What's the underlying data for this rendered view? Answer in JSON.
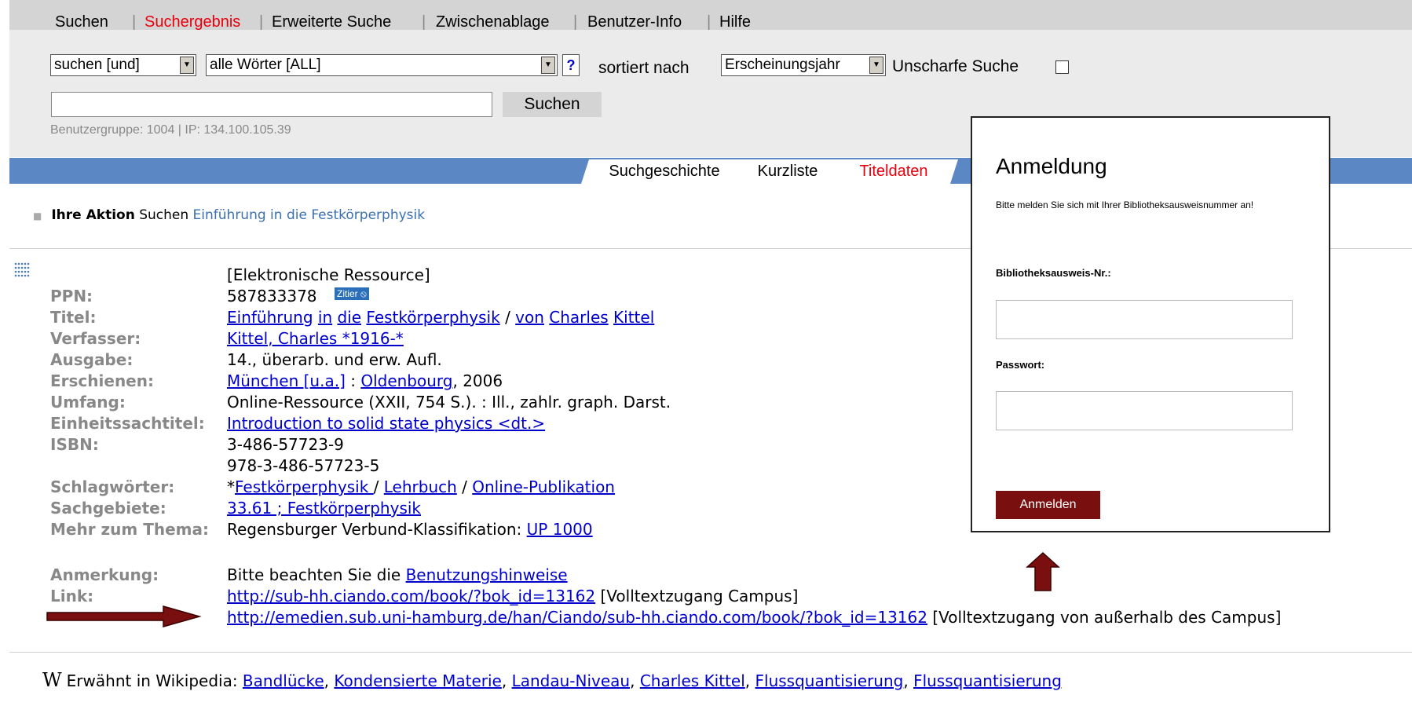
{
  "menu": {
    "items": [
      "Suchen",
      "Suchergebnis",
      "Erweiterte Suche",
      "Zwischenablage",
      "Benutzer-Info",
      "Hilfe"
    ],
    "active_index": 1,
    "active_color": "#e8000d"
  },
  "search": {
    "operator_value": "suchen [und]",
    "field_value": "alle Wörter [ALL]",
    "help_label": "?",
    "sort_label": "sortiert nach",
    "sort_value": "Erscheinungsjahr",
    "fuzzy_label": "Unscharfe Suche",
    "fuzzy_checked": false,
    "query_value": "",
    "submit_label": "Suchen",
    "user_info": "Benutzergruppe: 1004 | IP: 134.100.105.39"
  },
  "tabs": {
    "items": [
      "Suchgeschichte",
      "Kurzliste",
      "Titeldaten"
    ],
    "active_index": 2,
    "bar_color": "#5b87c5"
  },
  "action": {
    "label": "Ihre Aktion",
    "verb": "Suchen",
    "query": "Einführung in die Festkörperphysik"
  },
  "record": {
    "resource_type": "[Elektronische Ressource]",
    "ppn_label": "PPN:",
    "ppn": "587833378",
    "zitier_label": "Zitier",
    "title_label": "Titel:",
    "title_words": [
      "Einführung",
      "in",
      "die",
      "Festkörperphysik",
      "/",
      "von",
      "Charles",
      "Kittel"
    ],
    "author_label": "Verfasser:",
    "author": "Kittel, Charles *1916-*",
    "edition_label": "Ausgabe:",
    "edition": "14., überarb. und erw. Aufl.",
    "published_label": "Erschienen:",
    "published_place": "München [u.a.]",
    "published_sep": " : ",
    "published_publisher": "Oldenbourg",
    "published_year": ", 2006",
    "extent_label": "Umfang:",
    "extent": "Online-Ressource (XXII, 754 S.). : Ill., zahlr. graph. Darst.",
    "uniform_title_label": "Einheitssachtitel:",
    "uniform_title": "Introduction to solid state physics <dt.>",
    "isbn_label": "ISBN:",
    "isbn_1": "3-486-57723-9",
    "isbn_2": "978-3-486-57723-5",
    "subjects_label": "Schlagwörter:",
    "subject_prefix": "*",
    "subject_1": "Festkörperphysik ",
    "subject_2": "Lehrbuch",
    "subject_3": "Online-Publikation",
    "subjects_sep": " / ",
    "classification_label": "Sachgebiete:",
    "classification": "33.61 ; Festkörperphysik",
    "more_label": "Mehr zum Thema:",
    "more_text": "Regensburger Verbund-Klassifikation: ",
    "more_link": "UP 1000",
    "note_label": "Anmerkung:",
    "note_text": "Bitte beachten Sie die ",
    "note_link": "Benutzungshinweise",
    "link_label": "Link:",
    "link_1_url": "http://sub-hh.ciando.com/book/?bok_id=13162",
    "link_1_note": " [Volltextzugang Campus]",
    "link_2_url": "http://emedien.sub.uni-hamburg.de/han/Ciando/sub-hh.ciando.com/book/?bok_id=13162",
    "link_2_note": " [Volltextzugang von außerhalb des Campus]"
  },
  "login": {
    "title": "Anmeldung",
    "subtitle": "Bitte melden Sie sich mit Ihrer Bibliotheksausweisnummer an!",
    "card_label": "Bibliotheksausweis-Nr.:",
    "card_value": "",
    "password_label": "Passwort:",
    "password_value": "",
    "submit_label": "Anmelden",
    "button_color": "#7a0f0f"
  },
  "annotation": {
    "arrow_color": "#7a0f0f"
  },
  "wiki": {
    "icon": "W",
    "label": "Erwähnt in Wikipedia: ",
    "links": [
      "Bandlücke",
      "Kondensierte Materie",
      "Landau-Niveau",
      "Charles Kittel",
      "Flussquantisierung",
      "Flussquantisierung"
    ]
  }
}
